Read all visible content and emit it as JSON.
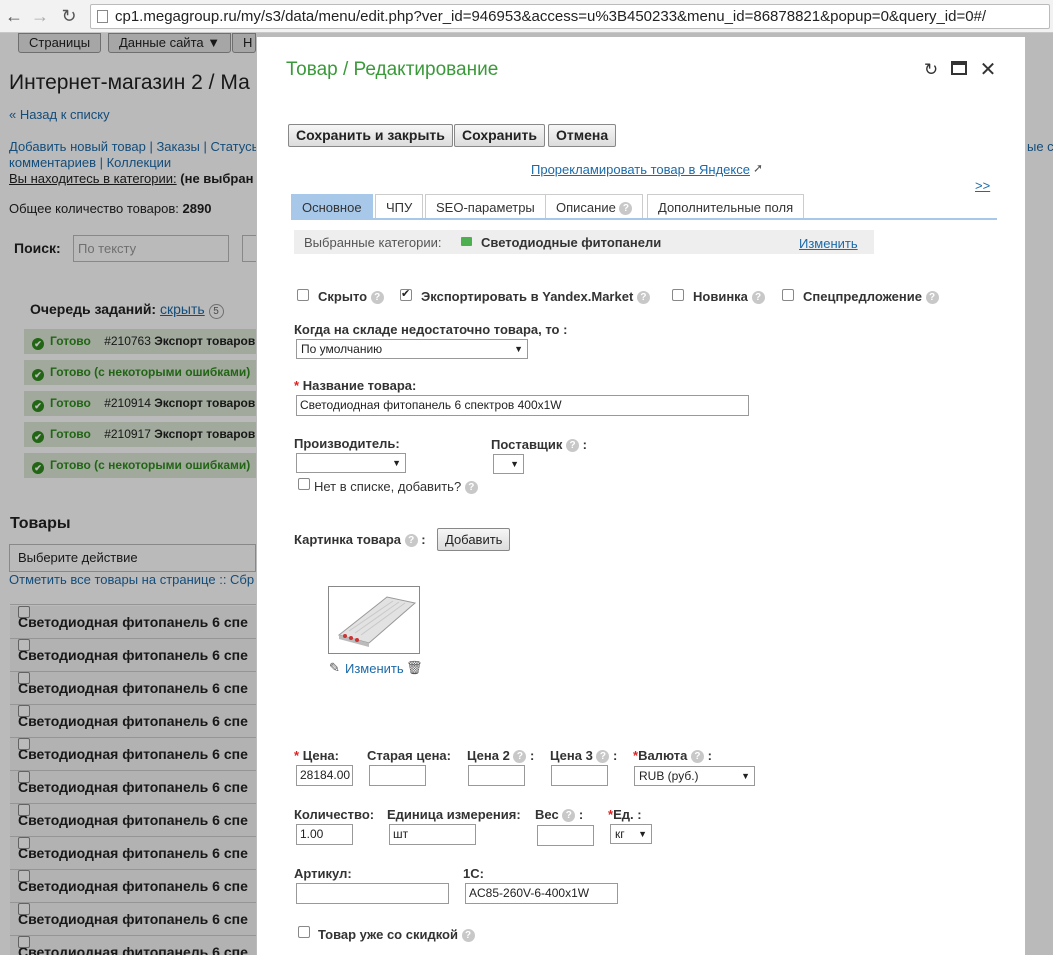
{
  "browser": {
    "url": "cp1.megagroup.ru/my/s3/data/menu/edit.php?ver_id=946953&access=u%3B450233&menu_id=86878821&popup=0&query_id=0#/"
  },
  "background": {
    "topnav": [
      "Страницы",
      "Данные сайта ▼",
      "Н"
    ],
    "page_title": "Интернет-магазин 2 / Ма",
    "back_link": "« Назад к списку",
    "links_line1": "Добавить новый товар | Заказы | Статусы",
    "links_line2": "комментариев | Коллекции",
    "right_links": "ые сп",
    "category_prefix": "Вы находитесь в категории:",
    "category_value": "(не выбран",
    "total_label": "Общее количество товаров:",
    "total_value": "2890",
    "search_label": "Поиск:",
    "search_placeholder": "По тексту",
    "queue_label": "Очередь заданий:",
    "queue_hide": "скрыть",
    "queue_count": "5",
    "tasks": [
      {
        "status": "Готово",
        "id": "#210763",
        "name": "Экспорт товаров"
      },
      {
        "status": "Готово (с некоторыми ошибками)",
        "id": "",
        "name": ""
      },
      {
        "status": "Готово",
        "id": "#210914",
        "name": "Экспорт товаров"
      },
      {
        "status": "Готово",
        "id": "#210917",
        "name": "Экспорт товаров"
      },
      {
        "status": "Готово (с некоторыми ошибками)",
        "id": "",
        "name": ""
      }
    ],
    "products_heading": "Товары",
    "action_select": "Выберите действие",
    "mark_all": "Отметить все товары на странице",
    "mark_sep": ":: Сбр",
    "rows": [
      "Светодиодная фитопанель 6 спе",
      "Светодиодная фитопанель 6 спе",
      "Светодиодная фитопанель 6 спе",
      "Светодиодная фитопанель 6 спе",
      "Светодиодная фитопанель 6 спе",
      "Светодиодная фитопанель 6 спе",
      "Светодиодная фитопанель 6 спе",
      "Светодиодная фитопанель 6 спе",
      "Светодиодная фитопанель 6 спе",
      "Светодиодная фитопанель 6 спе",
      "Светодиодная фитопанель 6 спе"
    ]
  },
  "modal": {
    "title": "Товар / Редактирование",
    "buttons": {
      "save_close": "Сохранить и закрыть",
      "save": "Сохранить",
      "cancel": "Отмена"
    },
    "yandex_link": "Прорекламировать товар в Яндексе",
    "expand_link": ">>",
    "tabs": [
      "Основное",
      "ЧПУ",
      "SEO-параметры",
      "Описание",
      "Дополнительные поля"
    ],
    "categories": {
      "label": "Выбранные категории:",
      "value": "Светодиодные фитопанели",
      "change": "Изменить"
    },
    "flags": [
      {
        "label": "Скрыто",
        "checked": false
      },
      {
        "label": "Экспортировать в Yandex.Market",
        "checked": true
      },
      {
        "label": "Новинка",
        "checked": false
      },
      {
        "label": "Спецпредложение",
        "checked": false
      }
    ],
    "stock_label": "Когда на складе недостаточно товара, то :",
    "stock_value": "По умолчанию",
    "name_label": "Название товара:",
    "name_value": "Светодиодная фитопанель 6 спектров 400x1W",
    "manufacturer_label": "Производитель:",
    "supplier_label": "Поставщик",
    "not_in_list": "Нет в списке, добавить?",
    "image_label": "Картинка товара",
    "image_add": "Добавить",
    "image_change": "Изменить",
    "price_label": "Цена:",
    "price_value": "28184.00",
    "old_price_label": "Старая цена:",
    "price2_label": "Цена 2",
    "price3_label": "Цена 3",
    "currency_label": "Валюта",
    "currency_value": "RUB (руб.)",
    "qty_label": "Количество:",
    "qty_value": "1.00",
    "unit_label": "Единица измерения:",
    "unit_value": "шт",
    "weight_label": "Вес",
    "weight_unit_label": "Ед. :",
    "weight_unit_value": "кг",
    "sku_label": "Артикул:",
    "c1_label": "1С:",
    "c1_value": "AC85-260V-6-400x1W",
    "discount_label": "Товар уже со скидкой"
  }
}
